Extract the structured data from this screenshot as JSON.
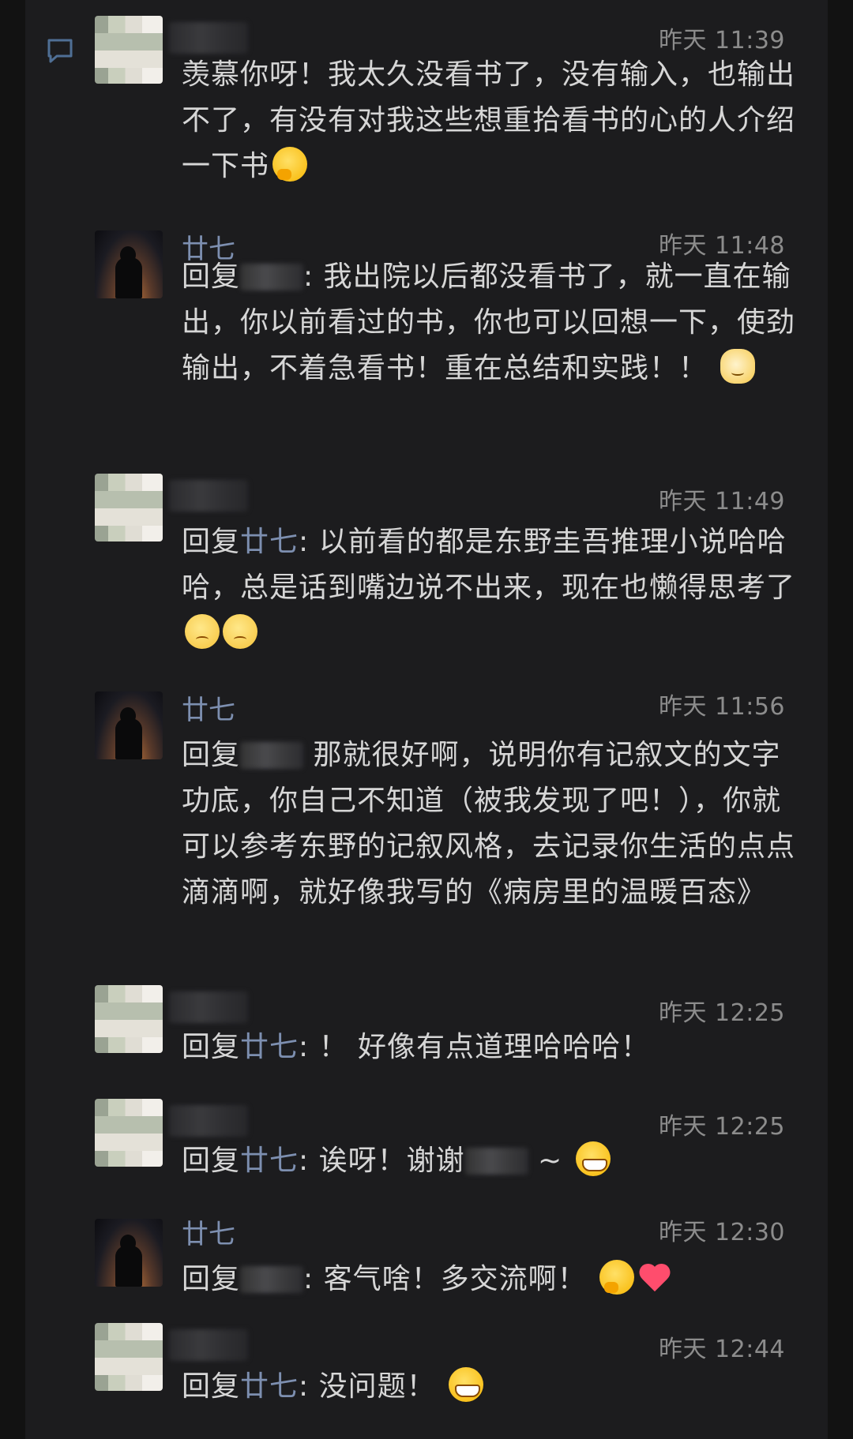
{
  "comments": [
    {
      "author": "",
      "time": "昨天 11:39",
      "reply_prefix": "",
      "reply_to": "",
      "text": "羡慕你呀！我太久没看书了，没有输入，也输出不了，有没有对我这些想重拾看书的心的人介绍一下书",
      "emojis": [
        "smirk-emoji"
      ]
    },
    {
      "author": "廿七",
      "time": "昨天 11:48",
      "reply_prefix": "回复",
      "reply_to": "",
      "text": ": 我出院以后都没看书了，就一直在输出，你以前看过的书，你也可以回想一下，使劲输出，不着急看书！重在总结和实践！！",
      "emojis": [
        "cat-emoji"
      ]
    },
    {
      "author": "",
      "time": "昨天 11:49",
      "reply_prefix": "回复",
      "reply_to": "廿七",
      "text": ": 以前看的都是东野圭吾推理小说哈哈哈，总是话到嘴边说不出来，现在也懒得思考了",
      "emojis": [
        "worried-emoji",
        "worried-emoji"
      ]
    },
    {
      "author": "廿七",
      "time": "昨天 11:56",
      "reply_prefix": "回复",
      "reply_to": "",
      "text": " 那就很好啊，说明你有记叙文的文字功底，你自己不知道（被我发现了吧！），你就可以参考东野的记叙风格，去记录你生活的点点滴滴啊，就好像我写的《病房里的温暖百态》",
      "emojis": []
    },
    {
      "author": "",
      "time": "昨天 12:25",
      "reply_prefix": "回复",
      "reply_to": "廿七",
      "text": ": ！ 好像有点道理哈哈哈！",
      "emojis": []
    },
    {
      "author": "",
      "time": "昨天 12:25",
      "reply_prefix": "回复",
      "reply_to": "廿七",
      "text": ": 诶呀！谢谢",
      "text_after": " ~",
      "emojis": [
        "grin-emoji"
      ]
    },
    {
      "author": "廿七",
      "time": "昨天 12:30",
      "reply_prefix": "回复",
      "reply_to": "",
      "text": ": 客气啥！多交流啊！",
      "emojis": [
        "smirk-emoji",
        "heart-emoji"
      ]
    },
    {
      "author": "",
      "time": "昨天 12:44",
      "reply_prefix": "回复",
      "reply_to": "廿七",
      "text": ": 没问题！",
      "emojis": [
        "grin-emoji"
      ]
    }
  ],
  "colors": {
    "background": "#121212",
    "panel": "#1c1c1e",
    "name": "#7d8fb0",
    "text": "#d6d6d6",
    "time": "#8c8c8c"
  },
  "icons": {
    "comment_icon": "comment-bubble-icon"
  }
}
